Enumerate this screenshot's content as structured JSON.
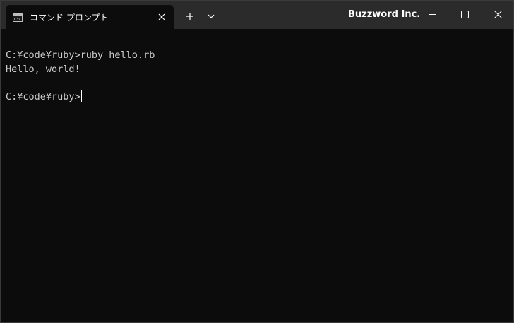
{
  "tab": {
    "title": "コマンド プロンプト",
    "icon": "command-prompt-icon"
  },
  "window": {
    "title": "Buzzword Inc.",
    "controls": [
      "minimize-icon",
      "maximize-icon",
      "close-icon"
    ]
  },
  "terminal": {
    "lines": [
      "C:¥code¥ruby>ruby hello.rb",
      "Hello, world!",
      "C:¥code¥ruby>"
    ]
  },
  "colors": {
    "titlebar": "#2b2b2b",
    "background": "#0c0c0c",
    "text": "#cccccc"
  }
}
